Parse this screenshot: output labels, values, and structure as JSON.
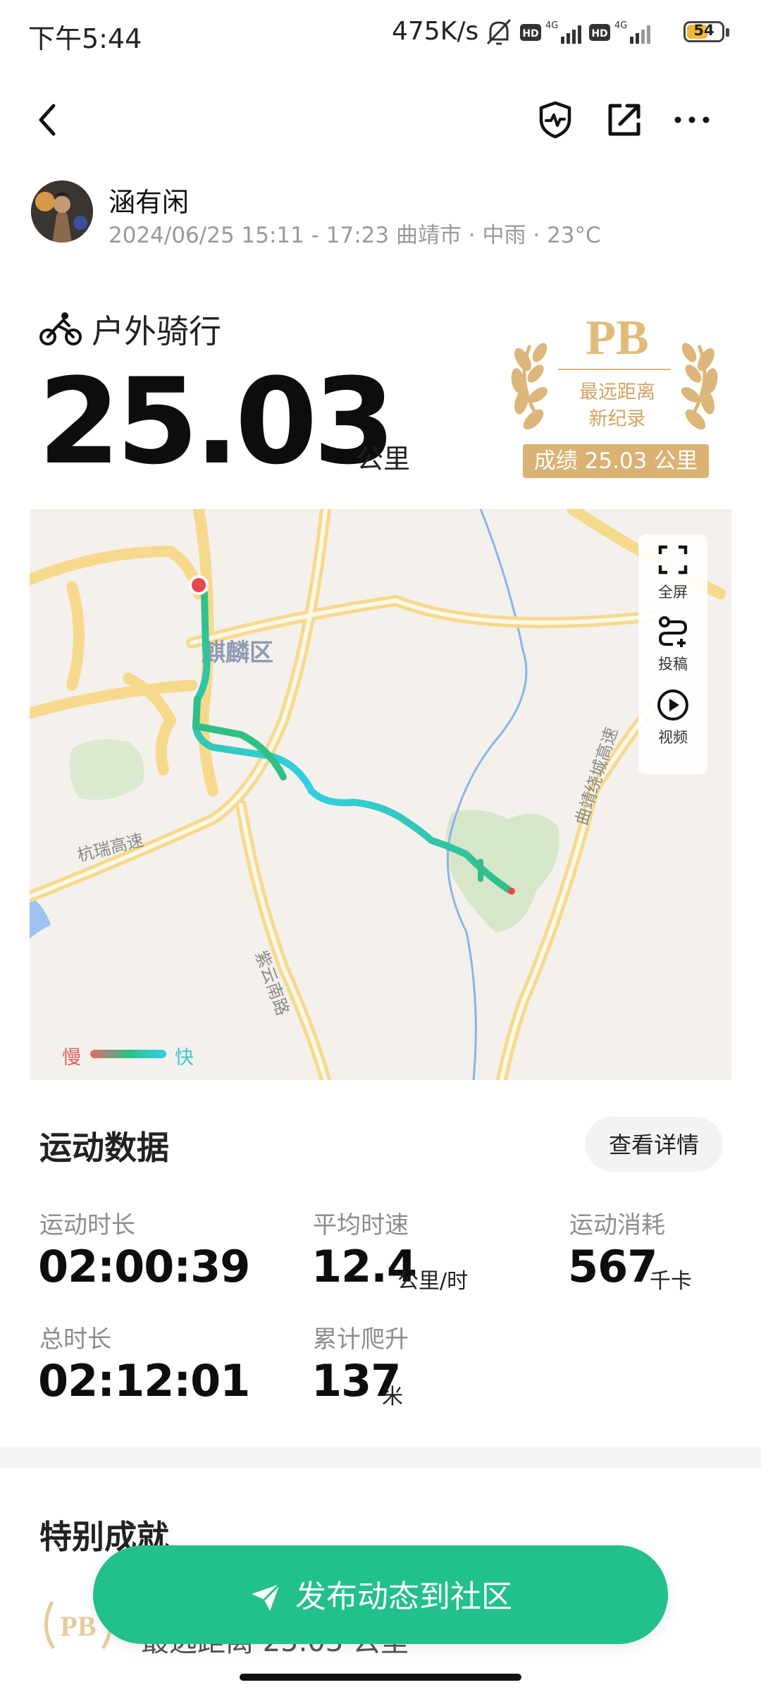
{
  "status_bar": {
    "time": "下午5:44",
    "net_speed": "475K/s",
    "hd_label": "HD",
    "network_label": "4G",
    "battery": "54"
  },
  "header": {
    "icons": [
      "back-icon",
      "shield-heart-icon",
      "share-icon",
      "more-icon"
    ]
  },
  "user": {
    "name": "涵有闲",
    "meta": "2024/06/25 15:11 - 17:23 曲靖市 · 中雨 · 23°C"
  },
  "activity": {
    "type": "户外骑行",
    "distance": "25.03",
    "unit": "公里"
  },
  "pb_badge": {
    "letters": "PB",
    "line1": "最远距离",
    "line2": "新纪录",
    "score": "成绩 25.03 公里"
  },
  "map": {
    "district_label": "麒麟区",
    "road1": "杭瑞高速",
    "road2": "紫云南路",
    "road3": "曲靖绕城高速",
    "controls": [
      {
        "label": "全屏",
        "icon": "fullscreen-icon"
      },
      {
        "label": "投稿",
        "icon": "route-submit-icon"
      },
      {
        "label": "视频",
        "icon": "play-video-icon"
      }
    ],
    "legend_slow": "慢",
    "legend_fast": "快",
    "colors": {
      "route_fast": "#33d0e6",
      "route_mid": "#2fbf86",
      "route_slow": "#e46a6a"
    }
  },
  "stats": {
    "title": "运动数据",
    "detail_button": "查看详情",
    "items": [
      {
        "label": "运动时长",
        "value": "02:00:39",
        "unit": ""
      },
      {
        "label": "平均时速",
        "value": "12.4",
        "unit": "公里/时"
      },
      {
        "label": "运动消耗",
        "value": "567",
        "unit": "千卡"
      },
      {
        "label": "总时长",
        "value": "02:12:01",
        "unit": ""
      },
      {
        "label": "累计爬升",
        "value": "137",
        "unit": "米"
      }
    ]
  },
  "achievements": {
    "title": "特别成就",
    "item_text": "最远距离 25.03 公里",
    "badge_letters": "PB"
  },
  "publish_button": "发布动态到社区",
  "accent_color": "#22c18a"
}
